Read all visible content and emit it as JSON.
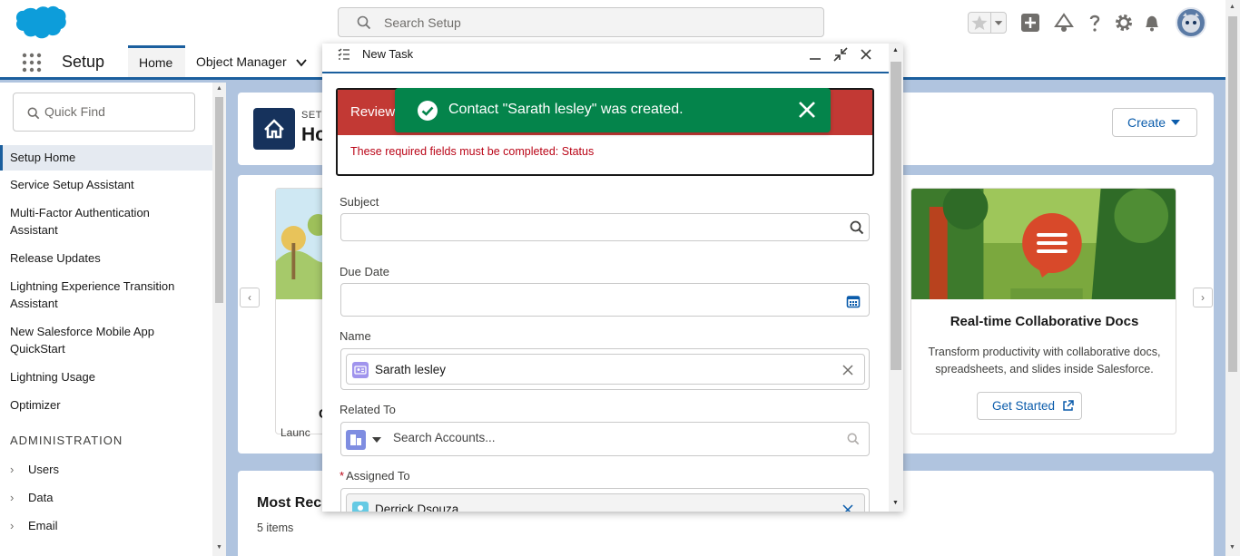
{
  "header": {
    "search_placeholder": "Search Setup"
  },
  "app_nav": {
    "app_name": "Setup",
    "tabs": [
      {
        "label": "Home"
      },
      {
        "label": "Object Manager"
      }
    ]
  },
  "sidebar": {
    "quick_find_placeholder": "Quick Find",
    "items": [
      {
        "label": "Setup Home"
      },
      {
        "label": "Service Setup Assistant"
      },
      {
        "label": "Multi-Factor Authentication Assistant"
      },
      {
        "label": "Release Updates"
      },
      {
        "label": "Lightning Experience Transition Assistant"
      },
      {
        "label": "New Salesforce Mobile App QuickStart"
      },
      {
        "label": "Lightning Usage"
      },
      {
        "label": "Optimizer"
      }
    ],
    "section_heading": "ADMINISTRATION",
    "tree": [
      {
        "label": "Users"
      },
      {
        "label": "Data"
      },
      {
        "label": "Email"
      }
    ]
  },
  "main": {
    "page_subtitle": "SETU",
    "page_title": "Ho",
    "create_label": "Create",
    "left_card_title": "C",
    "left_card_text": "Launc",
    "card": {
      "title": "Real-time Collaborative Docs",
      "description": "Transform productivity with collaborative docs, spreadsheets, and slides inside Salesforce.",
      "button_label": "Get Started"
    },
    "recent": {
      "title": "Most Rec",
      "count": "5 items"
    }
  },
  "modal": {
    "title": "New Task",
    "error_header": "Review",
    "error_message": "These required fields must be completed: Status",
    "fields": {
      "subject_label": "Subject",
      "due_date_label": "Due Date",
      "name_label": "Name",
      "name_value": "Sarath lesley",
      "related_label": "Related To",
      "related_placeholder": "Search Accounts...",
      "assigned_required": "*",
      "assigned_label": "Assigned To",
      "assigned_value": "Derrick Dsouza"
    }
  },
  "toast": {
    "message": "Contact \"Sarath lesley\" was created."
  },
  "colors": {
    "brand": "#1b5f9e",
    "error": "#c23934",
    "success": "#04844b",
    "link": "#0b5cab"
  }
}
